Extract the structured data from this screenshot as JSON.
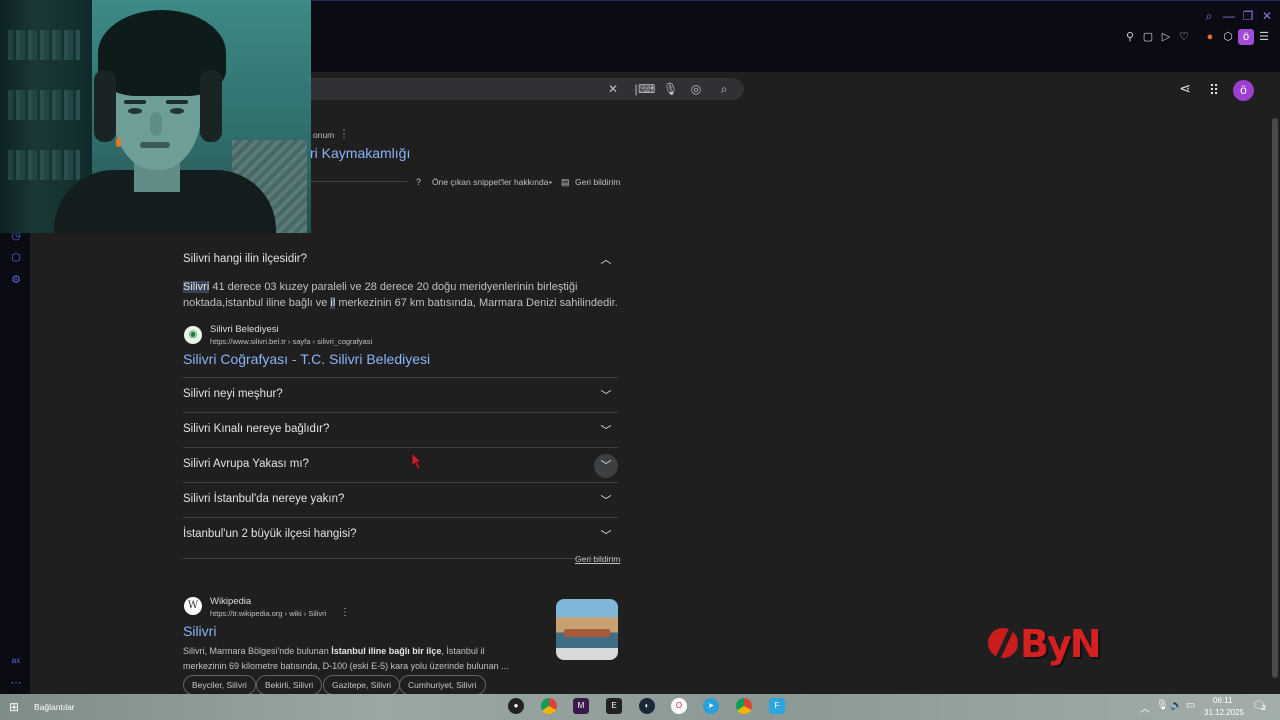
{
  "browser": {
    "profile_initial": "ö",
    "window_controls": [
      "search-icon",
      "minimize-icon",
      "restore-icon",
      "close-icon"
    ],
    "toolbar_icons": [
      "pin-icon",
      "screenshot-icon",
      "play-icon",
      "heart-icon",
      "extension-icon",
      "puzzle-icon",
      "menu-icon"
    ]
  },
  "google": {
    "avatar_initial": "ö"
  },
  "featured_snippet": {
    "source_fragment": "onum",
    "title_fragment": "ri Kaymakamlığı",
    "about_link": "Öne çıkan snippet'ler hakkında",
    "separator": "•",
    "feedback": "Geri bildirim"
  },
  "paa": {
    "expanded_question": "Silivri hangi ilin ilçesidir?",
    "answer": {
      "highlight1": "Silivri",
      "text1": " 41 derece 03 kuzey paraleli ve 28 derece 20 doğu meridyenlerinin birleştiği",
      "text2_before": "noktada,istanbul iline bağlı ve ",
      "highlight2": "il",
      "text2_after": " merkezinin 67 km batısında, Marmara Denizi sahilindedir."
    },
    "source": {
      "name": "Silivri Belediyesi",
      "url": "https://www.silivri.bel.tr › sayfa › silivri_cografyasi",
      "title": "Silivri Coğrafyası - T.C. Silivri Belediyesi"
    },
    "questions": [
      "Silivri neyi meşhur?",
      "Silivri Kınalı nereye bağlıdır?",
      "Silivri Avrupa Yakası mı?",
      "Silivri İstanbul'da nereye yakın?",
      "İstanbul'un 2 büyük ilçesi hangisi?"
    ],
    "feedback": "Geri bildirim"
  },
  "wiki_result": {
    "site": "Wikipedia",
    "favicon_letter": "W",
    "url": "https://tr.wikipedia.org › wiki › Silivri",
    "title": "Silivri",
    "snippet1_before": "Silivri, Marmara Bölgesi'nde bulunan ",
    "snippet1_bold": "İstanbul iline bağlı bir ilçe",
    "snippet1_after": ", İstanbul il",
    "snippet2": "merkezinin 69 kilometre batısında, D-100 (eski E-5) kara yolu üzerinde bulunan ...",
    "chips": [
      "Beyciler, Silivri",
      "Bekirli, Silivri",
      "Gazitepe, Silivri",
      "Cumhuriyet, Silivri"
    ]
  },
  "logo": {
    "text": "ByN"
  },
  "taskbar": {
    "network_label": "Bağlantılar",
    "time": "06:11",
    "date": "31.12.2025",
    "notification_count": "2",
    "apps": [
      "obs",
      "chrome",
      "unknown-app",
      "epic-games",
      "steam",
      "opera",
      "telegram",
      "chrome-alt",
      "files"
    ]
  },
  "browser_sidebar_label": "ax"
}
